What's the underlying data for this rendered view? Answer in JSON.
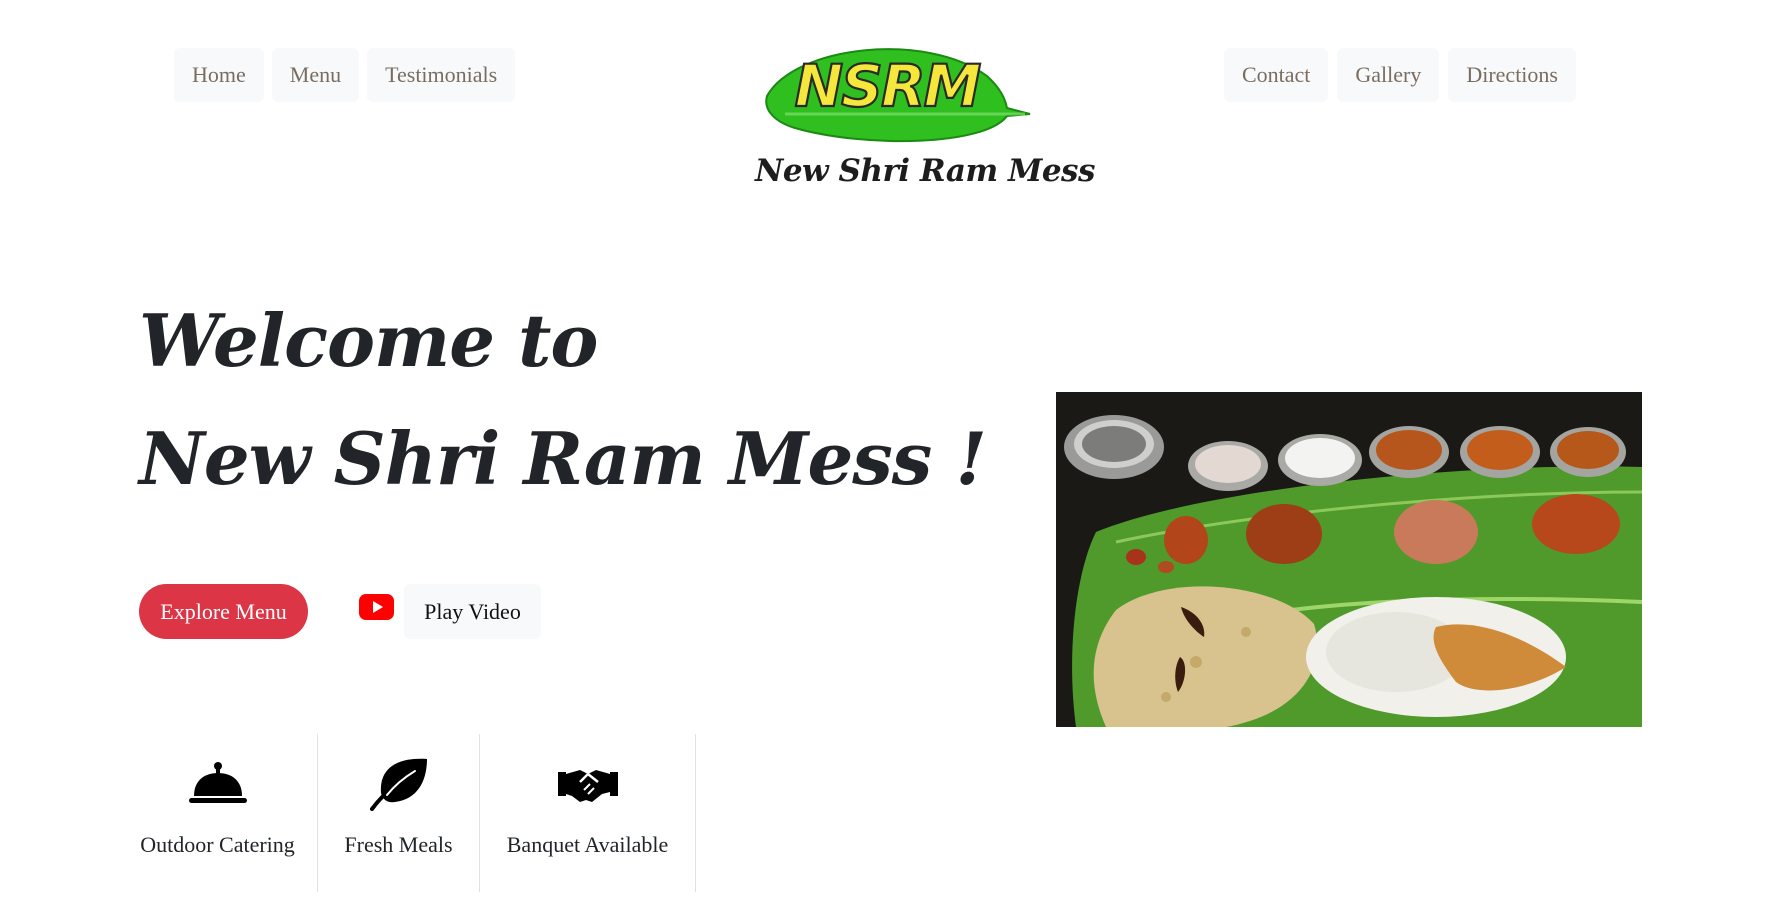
{
  "nav": {
    "left": [
      {
        "label": "Home"
      },
      {
        "label": "Menu"
      },
      {
        "label": "Testimonials"
      }
    ],
    "right": [
      {
        "label": "Contact"
      },
      {
        "label": "Gallery"
      },
      {
        "label": "Directions"
      }
    ]
  },
  "brand": {
    "logo_text": "NSRM",
    "name": "New Shri Ram Mess"
  },
  "hero": {
    "line1": "Welcome to",
    "line2": "New Shri Ram Mess !",
    "explore_button": "Explore Menu",
    "video_button": "Play Video",
    "video_icon": "youtube-icon"
  },
  "features": [
    {
      "icon": "service-bell-icon",
      "label": "Outdoor Catering"
    },
    {
      "icon": "leaf-icon",
      "label": "Fresh Meals"
    },
    {
      "icon": "handshake-icon",
      "label": "Banquet Available"
    }
  ],
  "colors": {
    "accent": "#dc3545",
    "nav_bg": "#f8f9fa",
    "nav_text": "#7a6d60",
    "logo_leaf": "#2fbf1f",
    "logo_letters": "#f5e73c",
    "youtube_red": "#ff0000"
  }
}
